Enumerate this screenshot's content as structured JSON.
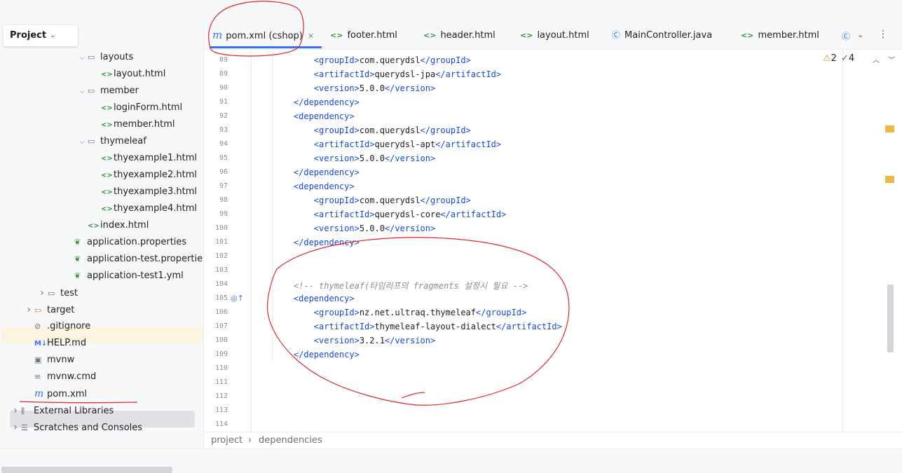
{
  "project_panel": {
    "title": "Project",
    "tree": [
      {
        "label": "layouts",
        "type": "folder",
        "expanded": true,
        "depth": 6
      },
      {
        "label": "layout.html",
        "type": "html",
        "depth": 7
      },
      {
        "label": "member",
        "type": "folder",
        "expanded": true,
        "depth": 6
      },
      {
        "label": "loginForm.html",
        "type": "html",
        "depth": 7
      },
      {
        "label": "member.html",
        "type": "html",
        "depth": 7
      },
      {
        "label": "thymeleaf",
        "type": "folder",
        "expanded": true,
        "depth": 6
      },
      {
        "label": "thyexample1.html",
        "type": "html",
        "depth": 7
      },
      {
        "label": "thyexample2.html",
        "type": "html",
        "depth": 7
      },
      {
        "label": "thyexample3.html",
        "type": "html",
        "depth": 7
      },
      {
        "label": "thyexample4.html",
        "type": "html",
        "depth": 7
      },
      {
        "label": "index.html",
        "type": "html",
        "depth": 6
      },
      {
        "label": "application.properties",
        "type": "props",
        "depth": 5
      },
      {
        "label": "application-test.propertie",
        "type": "props",
        "depth": 5
      },
      {
        "label": "application-test1.yml",
        "type": "props",
        "depth": 5
      },
      {
        "label": "test",
        "type": "folder",
        "expanded": false,
        "depth": 3
      },
      {
        "label": "target",
        "type": "folder-orange",
        "expanded": false,
        "depth": 2
      },
      {
        "label": ".gitignore",
        "type": "ignore",
        "depth": 2
      },
      {
        "label": "HELP.md",
        "type": "md",
        "depth": 2
      },
      {
        "label": "mvnw",
        "type": "shell",
        "depth": 2
      },
      {
        "label": "mvnw.cmd",
        "type": "text",
        "depth": 2
      },
      {
        "label": "pom.xml",
        "type": "maven",
        "depth": 2
      },
      {
        "label": "External Libraries",
        "type": "libs",
        "expanded": false,
        "depth": 1
      },
      {
        "label": "Scratches and Consoles",
        "type": "scratch",
        "expanded": false,
        "depth": 1
      }
    ]
  },
  "tabs": [
    {
      "label": "pom.xml (cshop)",
      "icon": "maven-icon",
      "active": true
    },
    {
      "label": "footer.html",
      "icon": "html-icon"
    },
    {
      "label": "header.html",
      "icon": "html-icon"
    },
    {
      "label": "layout.html",
      "icon": "html-icon"
    },
    {
      "label": "MainController.java",
      "icon": "class-icon"
    },
    {
      "label": "member.html",
      "icon": "html-icon"
    }
  ],
  "inspection": {
    "warnings": "2",
    "ok": "4"
  },
  "code_lines": [
    {
      "n": "89",
      "html": "        <span class=\"tag\">&lt;groupId&gt;</span>com.querydsl<span class=\"tag\">&lt;/groupId&gt;</span>"
    },
    {
      "n": "89",
      "html": "        <span class=\"tag\">&lt;artifactId&gt;</span>querydsl-jpa<span class=\"tag\">&lt;/artifactId&gt;</span>"
    },
    {
      "n": "90",
      "html": "        <span class=\"tag\">&lt;version&gt;</span>5.0.0<span class=\"tag\">&lt;/version&gt;</span>"
    },
    {
      "n": "91",
      "html": "    <span class=\"tag\">&lt;/dependency&gt;</span>"
    },
    {
      "n": "92",
      "html": "    <span class=\"tag\">&lt;dependency&gt;</span>"
    },
    {
      "n": "93",
      "html": "        <span class=\"tag\">&lt;groupId&gt;</span>com.querydsl<span class=\"tag\">&lt;/groupId&gt;</span>"
    },
    {
      "n": "94",
      "html": "        <span class=\"tag\">&lt;artifactId&gt;</span>querydsl-apt<span class=\"tag\">&lt;/artifactId&gt;</span>"
    },
    {
      "n": "95",
      "html": "        <span class=\"tag\">&lt;version&gt;</span>5.0.0<span class=\"tag\">&lt;/version&gt;</span>"
    },
    {
      "n": "96",
      "html": "    <span class=\"tag\">&lt;/dependency&gt;</span>"
    },
    {
      "n": "97",
      "html": "    <span class=\"tag\">&lt;dependency&gt;</span>"
    },
    {
      "n": "98",
      "html": "        <span class=\"tag\">&lt;groupId&gt;</span>com.querydsl<span class=\"tag\">&lt;/groupId&gt;</span>"
    },
    {
      "n": "99",
      "html": "        <span class=\"tag\">&lt;artifactId&gt;</span>querydsl-core<span class=\"tag\">&lt;/artifactId&gt;</span>"
    },
    {
      "n": "100",
      "html": "        <span class=\"tag\">&lt;version&gt;</span>5.0.0<span class=\"tag\">&lt;/version&gt;</span>"
    },
    {
      "n": "101",
      "html": "    <span class=\"tag\">&lt;/dependency&gt;</span>"
    },
    {
      "n": "102",
      "html": ""
    },
    {
      "n": "103",
      "html": ""
    },
    {
      "n": "104",
      "html": "    <span class=\"cm\">&lt;!-- thymeleaf(타임리프의 fragments 설정시 필요 --&gt;</span>"
    },
    {
      "n": "105",
      "html": "    <span class=\"tag\">&lt;dependency&gt;</span>"
    },
    {
      "n": "106",
      "html": "        <span class=\"tag\">&lt;groupId&gt;</span>nz.net.ultraq.thymeleaf<span class=\"tag\">&lt;/groupId&gt;</span>"
    },
    {
      "n": "107",
      "html": "        <span class=\"tag\">&lt;artifactId&gt;</span>thymeleaf-layout-dialect<span class=\"tag\">&lt;/artifactId&gt;</span>"
    },
    {
      "n": "108",
      "html": "        <span class=\"tag\">&lt;version&gt;</span>3.2.1<span class=\"tag\">&lt;/version&gt;</span>"
    },
    {
      "n": "109",
      "html": "    <span class=\"tag\">&lt;/dependency&gt;</span>"
    },
    {
      "n": "110",
      "html": ""
    },
    {
      "n": "111",
      "html": ""
    },
    {
      "n": "112",
      "html": ""
    },
    {
      "n": "113",
      "html": ""
    },
    {
      "n": "114",
      "html": ""
    }
  ],
  "breadcrumb": {
    "root": "project",
    "separator": "›",
    "leaf": "dependencies"
  },
  "colors": {
    "accent": "#3574f0",
    "tag": "#174ad4",
    "annotation": "#e0282c",
    "warning": "#e5a023"
  }
}
